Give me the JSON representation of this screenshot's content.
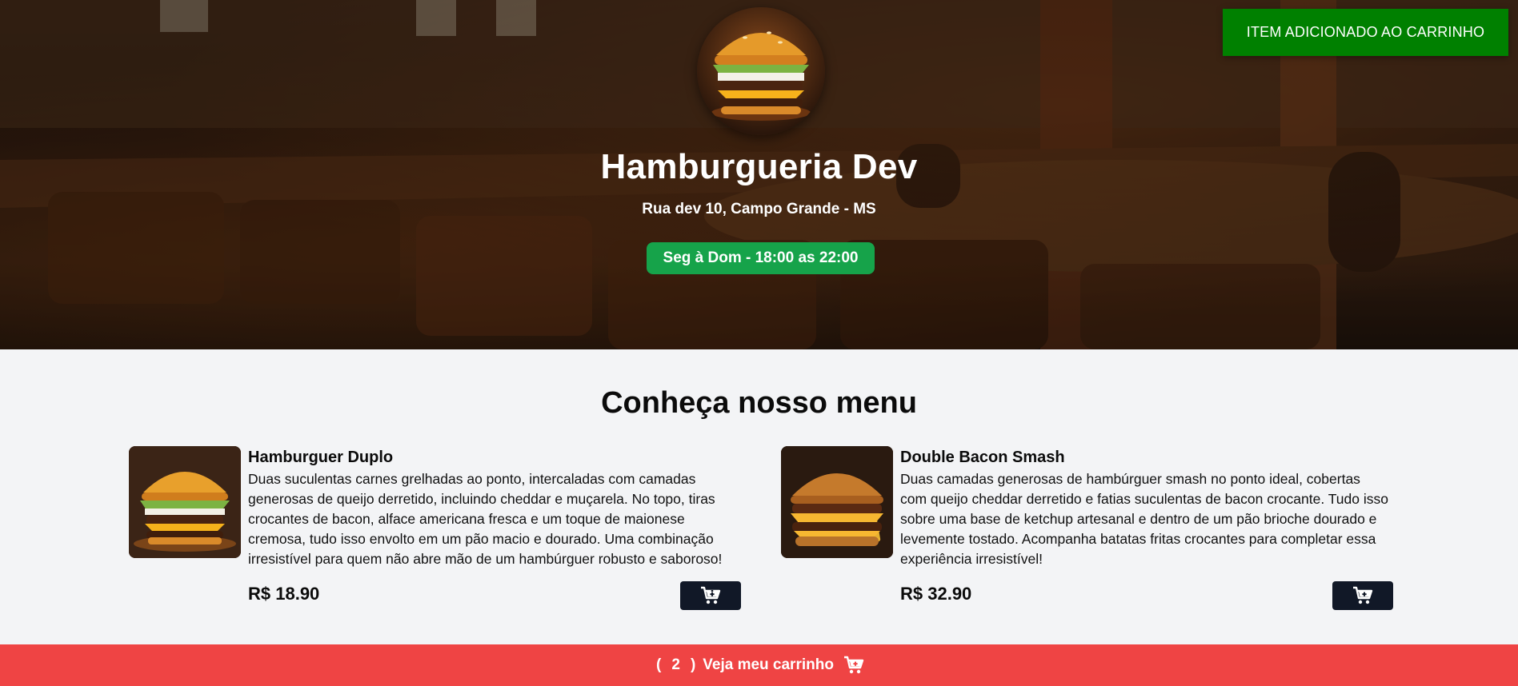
{
  "header": {
    "title": "Hamburgueria Dev",
    "address": "Rua dev 10, Campo Grande - MS",
    "hours": "Seg à Dom - 18:00 as 22:00"
  },
  "toast": {
    "message": "ITEM ADICIONADO AO CARRINHO",
    "color": "#008000"
  },
  "menu": {
    "heading": "Conheça nosso menu",
    "items": [
      {
        "name": "Hamburguer Duplo",
        "description": "Duas suculentas carnes grelhadas ao ponto, intercaladas com camadas generosas de queijo derretido, incluindo cheddar e muçarela. No topo, tiras crocantes de bacon, alface americana fresca e um toque de maionese cremosa, tudo isso envolto em um pão macio e dourado. Uma combinação irresistível para quem não abre mão de um hambúrguer robusto e saboroso!",
        "price": "R$ 18.90",
        "image_icon": "burger-photo"
      },
      {
        "name": "Double Bacon Smash",
        "description": "Duas camadas generosas de hambúrguer smash no ponto ideal, cobertas com queijo cheddar derretido e fatias suculentas de bacon crocante. Tudo isso sobre uma base de ketchup artesanal e dentro de um pão brioche dourado e levemente tostado. Acompanha batatas fritas crocantes para completar essa experiência irresistível!",
        "price": "R$ 32.90",
        "image_icon": "burger-photo"
      }
    ]
  },
  "cart": {
    "open_paren": "(",
    "count": "2",
    "close_paren": ")",
    "label": "Veja meu carrinho",
    "icon": "cart-plus-icon",
    "color": "#ef4444"
  },
  "colors": {
    "hours_badge": "#16a34a",
    "button_dark": "#111827"
  }
}
